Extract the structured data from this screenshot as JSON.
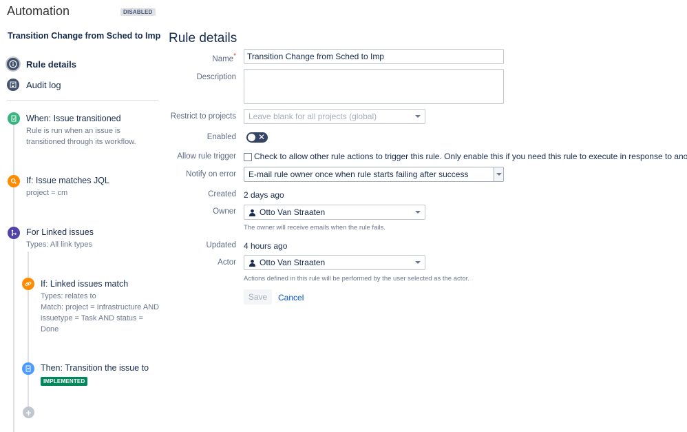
{
  "header": {
    "title": "Automation",
    "status": "DISABLED"
  },
  "rule": {
    "name": "Transition Change from Sched to Imp"
  },
  "nav": {
    "rule_details": "Rule details",
    "audit_log": "Audit log"
  },
  "steps": [
    {
      "title": "When: Issue transitioned",
      "desc": "Rule is run when an issue is transitioned through its workflow.",
      "icon": "trigger-icon",
      "color": "#36b37e"
    },
    {
      "title": "If: Issue matches JQL",
      "desc": "project = cm",
      "icon": "search-icon",
      "color": "#ff8b00"
    },
    {
      "title": "For Linked issues",
      "desc": "Types: All link types",
      "icon": "branch-icon",
      "color": "#5243aa"
    },
    {
      "title": "If: Linked issues match",
      "desc_lines": [
        "Types: relates to",
        "Match: project = Infrastructure AND issuetype = Task AND status = Done"
      ],
      "icon": "link-icon",
      "color": "#ff8b00"
    },
    {
      "title": "Then: Transition the issue to",
      "badge": "IMPLEMENTED",
      "icon": "action-icon",
      "color": "#4c9aff"
    }
  ],
  "form": {
    "title": "Rule details",
    "labels": {
      "name": "Name",
      "description": "Description",
      "restrict": "Restrict to projects",
      "enabled": "Enabled",
      "allow_trigger": "Allow rule trigger",
      "notify": "Notify on error",
      "created": "Created",
      "owner": "Owner",
      "updated": "Updated",
      "actor": "Actor"
    },
    "name_value": "Transition Change from Sched to Imp",
    "description_value": "",
    "restrict_placeholder": "Leave blank for all projects (global)",
    "enabled": false,
    "allow_trigger_text": "Check to allow other rule actions to trigger this rule. Only enable this if you need this rule to execute in response to another rule.",
    "allow_trigger_checked": false,
    "notify_value": "E-mail rule owner once when rule starts failing after success",
    "created_value": "2 days ago",
    "owner_value": "Otto Van Straaten",
    "owner_hint": "The owner will receive emails when the rule fails.",
    "updated_value": "4 hours ago",
    "actor_value": "Otto Van Straaten",
    "actor_hint": "Actions defined in this rule will be performed by the user selected as the actor.",
    "save_label": "Save",
    "cancel_label": "Cancel"
  }
}
